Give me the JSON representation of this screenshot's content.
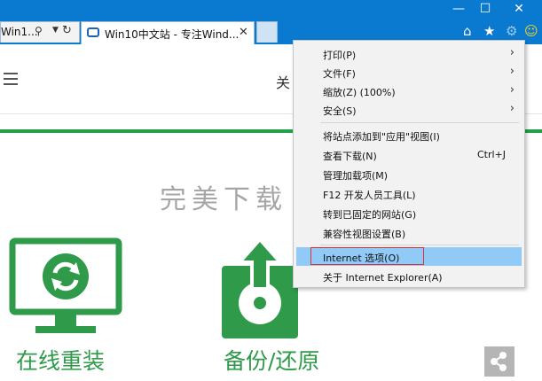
{
  "browser": {
    "tabs": [
      {
        "title": "Win1..."
      },
      {
        "title": "Win10中文站 - 专注Wind..."
      }
    ],
    "window_controls": {
      "minimize": "—",
      "maximize": "☐",
      "close": "✕"
    },
    "toolbar_icons": {
      "home": "⌂",
      "favorites": "★",
      "tools": "⚙",
      "feedback": "☺"
    },
    "accent_color": "#0a7ad0"
  },
  "page": {
    "nav_text": "关",
    "heading": "完美下载",
    "features": [
      {
        "label": "在线重装"
      },
      {
        "label": "备份/还原"
      }
    ],
    "brand_color": "#2e9a4a"
  },
  "menu": {
    "items": [
      {
        "label": "打印(P)",
        "arrow": "›"
      },
      {
        "label": "文件(F)",
        "arrow": "›"
      },
      {
        "label": "缩放(Z) (100%)",
        "arrow": "›"
      },
      {
        "label": "安全(S)",
        "arrow": "›"
      },
      {
        "label": "将站点添加到\"应用\"视图(I)"
      },
      {
        "label": "查看下载(N)",
        "shortcut": "Ctrl+J"
      },
      {
        "label": "管理加载项(M)"
      },
      {
        "label": "F12 开发人员工具(L)"
      },
      {
        "label": "转到已固定的网站(G)"
      },
      {
        "label": "兼容性视图设置(B)"
      },
      {
        "label": "Internet 选项(O)",
        "highlighted": true
      },
      {
        "label": "关于 Internet Explorer(A)"
      }
    ],
    "highlight_color": "#91c9f7"
  }
}
